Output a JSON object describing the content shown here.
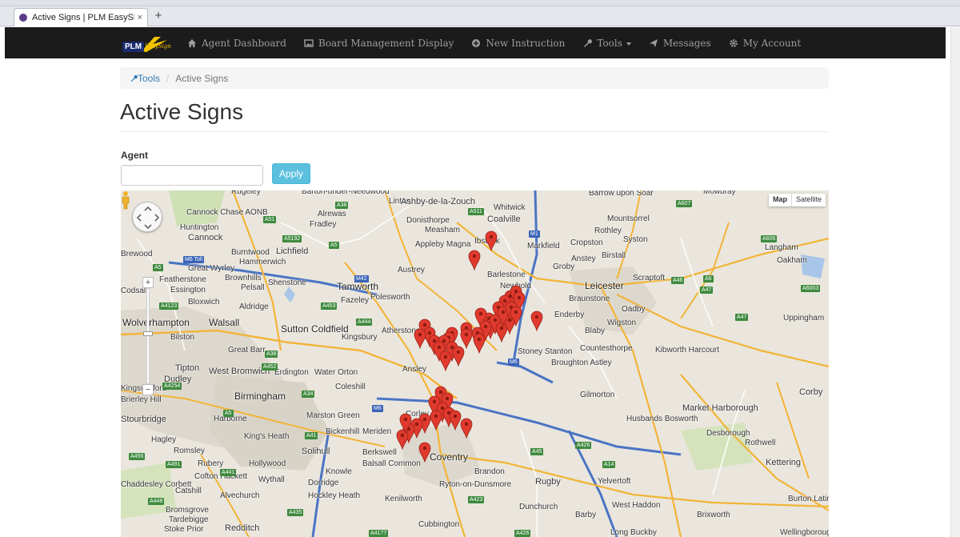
{
  "browser": {
    "tab_title": "Active Signs | PLM EasySig...",
    "tab_close": "×",
    "new_tab": "+"
  },
  "navbar": {
    "logo_text": "PLM",
    "logo_script": "EasySign",
    "items": [
      {
        "label": "Agent Dashboard",
        "icon": "home-icon"
      },
      {
        "label": "Board Management Display",
        "icon": "image-icon"
      },
      {
        "label": "New Instruction",
        "icon": "plus-circle-icon"
      },
      {
        "label": "Tools",
        "icon": "wrench-icon",
        "dropdown": true
      },
      {
        "label": "Messages",
        "icon": "send-icon"
      },
      {
        "label": "My Account",
        "icon": "gear-icon"
      }
    ]
  },
  "breadcrumb": {
    "link": "Tools",
    "current": "Active Signs"
  },
  "page": {
    "title": "Active Signs",
    "agent_label": "Agent",
    "agent_value": "",
    "apply_label": "Apply"
  },
  "map": {
    "map_button": "Map",
    "satellite_button": "Satellite",
    "zoom_in": "+",
    "zoom_out": "−",
    "places": [
      "Rugeley",
      "Barton-under-Needwood",
      "Linton",
      "Ashby-de-la-Zouch",
      "Whitwick",
      "Barrow upon Soar",
      "Mowbray",
      "Cannock Chase AONB",
      "Alrewas",
      "Donisthorpe",
      "Coalville",
      "Huntington",
      "Fradley",
      "Measham",
      "Mountsorrel",
      "Cannock",
      "Rothley",
      "Syston",
      "Ibstock",
      "Markfield",
      "Cropston",
      "Appleby Magna",
      "Lichfield",
      "Burntwood",
      "Hammerwich",
      "Brewood",
      "Anstey",
      "Birstall",
      "Langham",
      "Oakham",
      "Great Wyrley",
      "Austrey",
      "Featherstone",
      "Brownhills",
      "Shenstone",
      "Groby",
      "Barlestone",
      "Scraptoft",
      "Leicester",
      "Codsall",
      "Pelsall",
      "Essington",
      "Tamworth",
      "Newbold",
      "Bloxwich",
      "Fazeley",
      "Polesworth",
      "Braunstone",
      "Oadby",
      "Aldridge",
      "Enderby",
      "Wolverhampton",
      "Walsall",
      "Wigston",
      "Uppingham",
      "Atherstone",
      "Blaby",
      "Sutton Coldfield",
      "Bilston",
      "Kingsbury",
      "Stoney Stanton",
      "Countesthorpe",
      "Kibworth Harcourt",
      "Great Barr",
      "Ansley",
      "Broughton Astley",
      "Tipton",
      "West Bromwich",
      "Erdington",
      "Water Orton",
      "Dudley",
      "Coleshill",
      "Kingswinford",
      "Brierley Hill",
      "Birmingham",
      "Gilmorton",
      "Corby",
      "Harborne",
      "Corley",
      "Marston Green",
      "Stourbridge",
      "Market Harborough",
      "King's Heath",
      "Husbands Bosworth",
      "Meriden",
      "Desborough",
      "Bickenhill",
      "Hagley",
      "Solihull",
      "Berkswell",
      "Romsley",
      "Balsall Common",
      "Rothwell",
      "Rubery",
      "Hollywood",
      "Coventry",
      "Kettering",
      "Knowle",
      "Brandon",
      "Cofton Hackett",
      "Wythall",
      "Chaddesley Corbett",
      "Dorridge",
      "Ryton-on-Dunsmore",
      "Rugby",
      "Catshill",
      "Yelvertoft",
      "Alvechurch",
      "Hockley Heath",
      "Kenilworth",
      "Burton Latimer",
      "Dunchurch",
      "West Haddon",
      "Bromsgrove",
      "Tardebigge",
      "Barby",
      "Brixworth",
      "Stoke Prior",
      "Redditch",
      "Cubbington",
      "Long Buckby",
      "Wellingborough"
    ],
    "road_shields": [
      "A51",
      "A38",
      "A511",
      "A606",
      "A607",
      "A5192",
      "A5",
      "M1",
      "A46",
      "A6",
      "A453",
      "A47",
      "M6 Toll",
      "A5",
      "M42",
      "A4123",
      "A444",
      "A38",
      "A452",
      "A41",
      "M6",
      "A34",
      "A45",
      "A5",
      "M6",
      "A426",
      "A14",
      "A4177",
      "A426",
      "A435",
      "A441",
      "A448",
      "A456",
      "A491",
      "A423",
      "A6003",
      "A47",
      "A4254"
    ],
    "marker_color": "#e03a2e"
  }
}
